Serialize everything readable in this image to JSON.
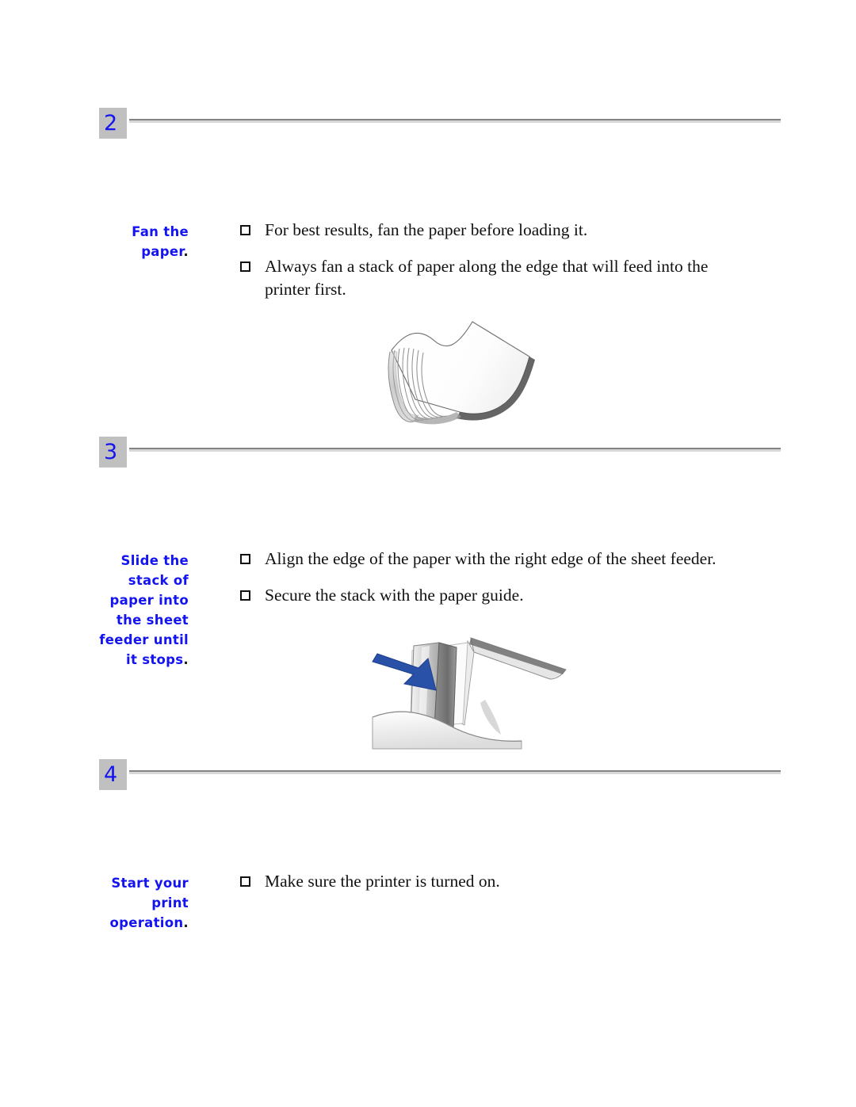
{
  "page": {
    "background": "#ffffff",
    "accent_blue": "#1414f0",
    "badge_gray": "#c0c0c0",
    "rule_gray": "#848484",
    "text_black": "#111111"
  },
  "steps": [
    {
      "number": "2",
      "label_lines": [
        "Fan the",
        "paper"
      ],
      "label_period": ".",
      "bullets": [
        "For best results, fan the paper before loading it.",
        "Always fan a stack of paper along the edge that will feed into the printer first."
      ],
      "illustration": "fanned-paper-stack"
    },
    {
      "number": "3",
      "label_lines": [
        "Slide the",
        "stack of",
        "paper into",
        "the sheet",
        "feeder until",
        "it stops"
      ],
      "label_period": ".",
      "bullets": [
        "Align the edge of the paper with the right edge of the sheet feeder.",
        "Secure the stack with the paper guide."
      ],
      "illustration": "sheet-feeder-with-arrow"
    },
    {
      "number": "4",
      "label_lines": [
        "Start your",
        "print",
        "operation"
      ],
      "label_period": ".",
      "bullets": [
        "Make sure the printer is turned on."
      ],
      "illustration": null
    }
  ],
  "icons": {
    "bullet": "empty-checkbox-square",
    "arrow": "blue-right-down-arrow"
  }
}
